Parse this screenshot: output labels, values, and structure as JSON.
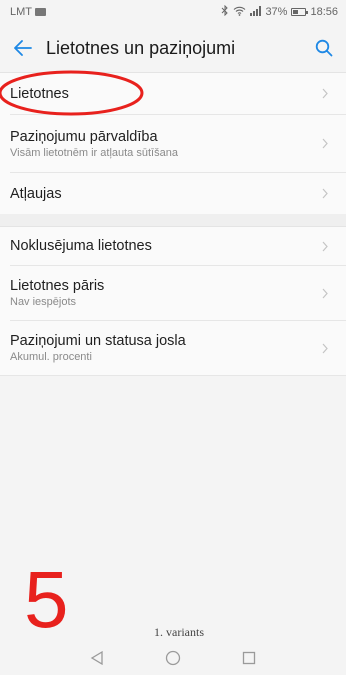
{
  "status_bar": {
    "carrier": "LMT",
    "battery": "37%",
    "time": "18:56",
    "icons": [
      "image-icon",
      "bluetooth-icon",
      "wifi-icon",
      "signal-icon",
      "battery-icon"
    ]
  },
  "header": {
    "title": "Lietotnes un paziņojumi",
    "back_icon": "arrow-left-icon",
    "search_icon": "search-icon",
    "accent": "#1e88e5"
  },
  "groups": [
    {
      "items": [
        {
          "label": "Lietotnes",
          "sub": ""
        },
        {
          "label": "Paziņojumu pārvaldība",
          "sub": "Visām lietotnēm ir atļauta sūtīšana"
        },
        {
          "label": "Atļaujas",
          "sub": ""
        }
      ]
    },
    {
      "items": [
        {
          "label": "Noklusējuma lietotnes",
          "sub": ""
        },
        {
          "label": "Lietotnes pāris",
          "sub": "Nav iespējots"
        },
        {
          "label": "Paziņojumi un statusa josla",
          "sub": "Akumul. procenti"
        }
      ]
    }
  ],
  "annotation": {
    "big_number": "5",
    "big_number_color": "#e8211d",
    "caption": "1. variants",
    "ellipse_color": "#e8211d"
  },
  "nav_bar": {
    "icons": [
      "back-triangle-icon",
      "home-circle-icon",
      "recents-square-icon"
    ]
  }
}
